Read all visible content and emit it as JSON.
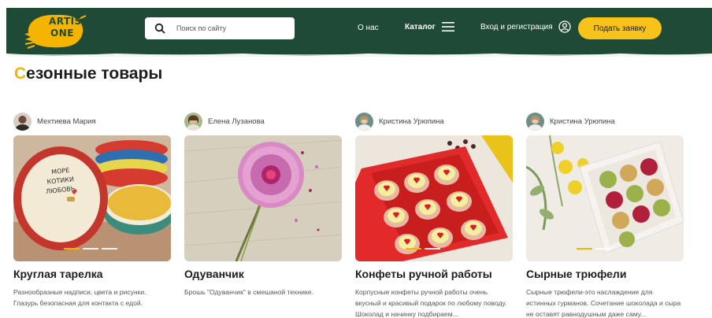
{
  "header": {
    "logo_text": "ARTIS ONE",
    "search_placeholder": "Поиск по сайту",
    "nav_about": "О нас",
    "nav_catalog": "Каталог",
    "nav_login": "Вход и регистрация",
    "cta_label": "Подать заявку"
  },
  "section": {
    "title_first_letter": "С",
    "title_rest": "езонные товары"
  },
  "cards": [
    {
      "author": "Мехтиева Мария",
      "title": "Круглая тарелка",
      "description": "Разнообразные надписи, цвета и рисунки. Глазурь безопасная для контакта с едой.",
      "plate_text": "МОРЕ КОТИКИ ЛЮБОВЬ"
    },
    {
      "author": "Елена Лузанова",
      "title": "Одуванчик",
      "description": "Брошь \"Одуванчик\" в смешаной технике."
    },
    {
      "author": "Кристина Урюпина",
      "title": "Конфеты ручной работы",
      "description": "Корпусные конфеты ручной работы очень вкусный и красивый подарок по любому поводу. Шоколад и начинку подбираем..."
    },
    {
      "author": "Кристина Урюпина",
      "title": "Сырные трюфели",
      "description": "Сырные трюфели-это наслаждение для истинных гурманов. Сочетание шоколада и сыра не оставят равнодушным даже саму..."
    }
  ],
  "colors": {
    "header_bg": "#1f4a36",
    "accent": "#f4b400",
    "cta_bg": "#f7c21a"
  },
  "icons": [
    "search-icon",
    "menu-icon",
    "user-icon"
  ]
}
